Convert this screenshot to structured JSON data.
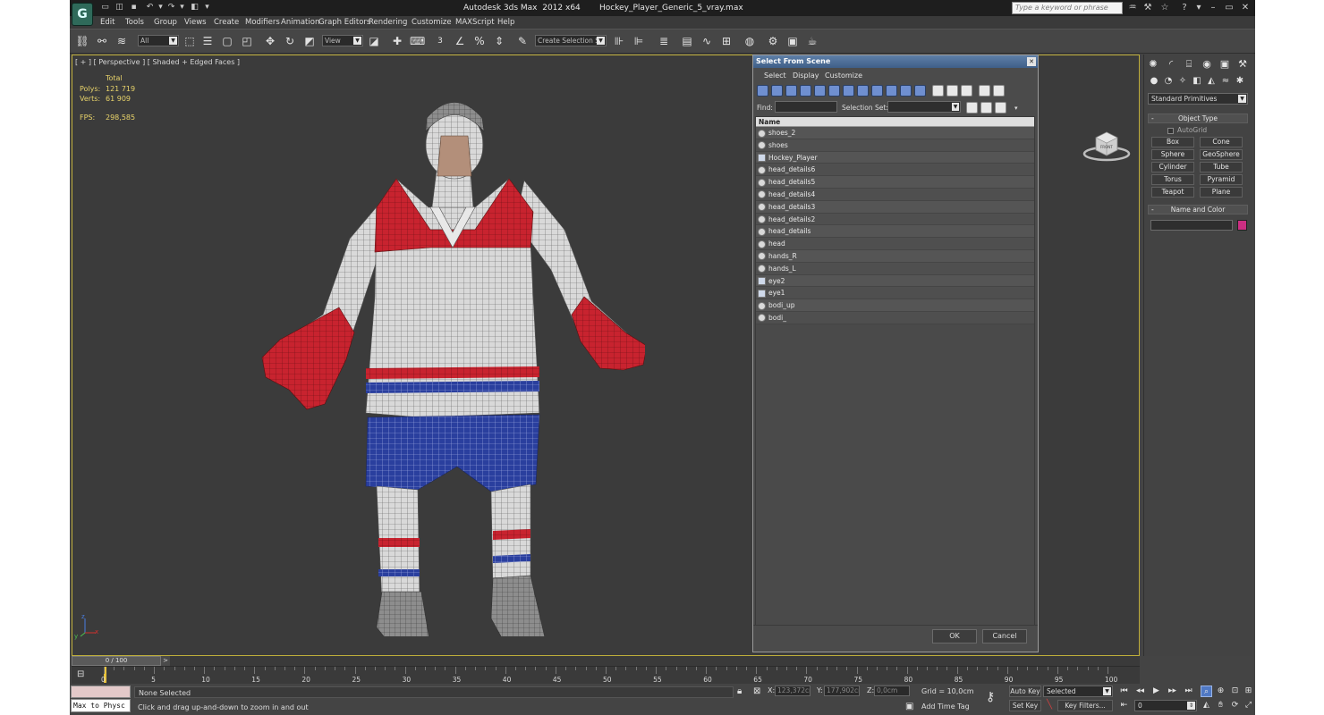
{
  "window": {
    "app_title": "Autodesk 3ds Max  2012 x64",
    "file_title": "Hockey_Player_Generic_5_vray.max",
    "search_placeholder": "Type a keyword or phrase"
  },
  "menu": [
    "Edit",
    "Tools",
    "Group",
    "Views",
    "Create",
    "Modifiers",
    "Animation",
    "Graph Editors",
    "Rendering",
    "Customize",
    "MAXScript",
    "Help"
  ],
  "toolbar": {
    "selection_filter": "All",
    "reference_coord": "View",
    "snaps_label": "3",
    "named_selection": "Create Selection Se"
  },
  "viewport": {
    "label": "[ + ] [ Perspective ] [ Shaded + Edged Faces ]",
    "stats": {
      "header": "Total",
      "polys_label": "Polys:",
      "polys_value": "121 719",
      "verts_label": "Verts:",
      "verts_value": "61 909",
      "fps_label": "FPS:",
      "fps_value": "298,585"
    },
    "axis": {
      "x": "x",
      "y": "y",
      "z": "z"
    },
    "viewcube_label": "FRONT"
  },
  "dialog": {
    "title": "Select From Scene",
    "menu": [
      "Select",
      "Display",
      "Customize"
    ],
    "find_label": "Find:",
    "selection_set_label": "Selection Set:",
    "column_name": "Name",
    "objects": [
      {
        "name": "shoes_2",
        "type": "geo"
      },
      {
        "name": "shoes",
        "type": "geo"
      },
      {
        "name": "Hockey_Player",
        "type": "group"
      },
      {
        "name": "head_details6",
        "type": "geo"
      },
      {
        "name": "head_details5",
        "type": "geo"
      },
      {
        "name": "head_details4",
        "type": "geo"
      },
      {
        "name": "head_details3",
        "type": "geo"
      },
      {
        "name": "head_details2",
        "type": "geo"
      },
      {
        "name": "head_details",
        "type": "geo"
      },
      {
        "name": "head",
        "type": "geo"
      },
      {
        "name": "hands_R",
        "type": "geo"
      },
      {
        "name": "hands_L",
        "type": "geo"
      },
      {
        "name": "eye2",
        "type": "group"
      },
      {
        "name": "eye1",
        "type": "group"
      },
      {
        "name": "bodi_up",
        "type": "geo"
      },
      {
        "name": "bodi_",
        "type": "geo"
      }
    ],
    "ok_label": "OK",
    "cancel_label": "Cancel"
  },
  "command_panel": {
    "category": "Standard Primitives",
    "object_type_title": "Object Type",
    "autogrid_label": "AutoGrid",
    "primitives": [
      "Box",
      "Cone",
      "Sphere",
      "GeoSphere",
      "Cylinder",
      "Tube",
      "Torus",
      "Pyramid",
      "Teapot",
      "Plane"
    ],
    "name_color_title": "Name and Color",
    "object_color": "#cc2e82"
  },
  "timeline": {
    "frame_display": "0 / 100",
    "ticks": [
      "0",
      "5",
      "10",
      "15",
      "20",
      "25",
      "30",
      "35",
      "40",
      "45",
      "50",
      "55",
      "60",
      "65",
      "70",
      "75",
      "80",
      "85",
      "90",
      "95",
      "100"
    ]
  },
  "status": {
    "maxscript_text": "Max to Physc",
    "selection_text": "None Selected",
    "prompt_text": "Click and drag up-and-down to zoom in and out",
    "x_label": "X:",
    "x_value": "123,372cm",
    "y_label": "Y:",
    "y_value": "177,902cm",
    "z_label": "Z:",
    "z_value": "0,0cm",
    "grid_text": "Grid = 10,0cm",
    "add_time_tag": "Add Time Tag",
    "auto_key": "Auto Key",
    "set_key": "Set Key",
    "key_mode": "Selected",
    "key_filters": "Key Filters...",
    "current_frame": "0"
  },
  "colors": {
    "jersey_red": "#c8232f",
    "jersey_blue": "#2a3f9e",
    "viewport_border": "#bfae3a"
  }
}
